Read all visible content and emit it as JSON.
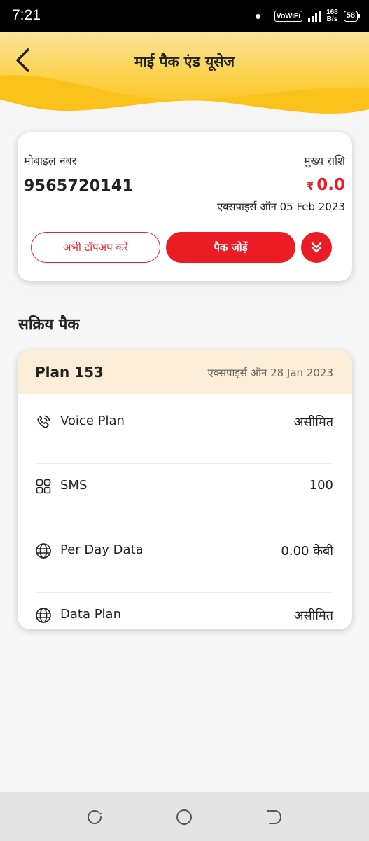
{
  "status_bar": {
    "time": "7:21",
    "network_label": "VoWiFi",
    "speed_value": "168",
    "speed_unit": "B/s",
    "battery": "58"
  },
  "header": {
    "title": "माई पैक एंड यूसेज",
    "gradient_top": "#fde29a",
    "gradient_bottom": "#fbc21c"
  },
  "balance_card": {
    "mobile_label": "मोबाइल नंबर",
    "mobile_number": "9565720141",
    "balance_label": "मुख्य राशि",
    "currency": "₹",
    "balance": "0.0",
    "expiry": "एक्सपाइर्स ऑन 05 Feb 2023",
    "topup_label": "अभी टॉपअप करें",
    "add_pack_label": "पैक जोड़ें",
    "accent_color": "#ec1c24"
  },
  "active_packs": {
    "section_title": "सक्रिय पैक",
    "plan": {
      "name": "Plan 153",
      "expiry": "एक्सपाइर्स ऑन 28 Jan 2023",
      "rows": [
        {
          "icon": "phone-call-icon",
          "label": "Voice Plan",
          "value": "असीमित"
        },
        {
          "icon": "grid-icon",
          "label": "SMS",
          "value": "100"
        },
        {
          "icon": "globe-icon",
          "label": "Per Day Data",
          "value": "0.00 केबी"
        },
        {
          "icon": "globe-icon",
          "label": "Data Plan",
          "value": "असीमित"
        }
      ]
    }
  },
  "nav_bar": {
    "icons": [
      "recent-apps-icon",
      "home-icon",
      "back-icon"
    ]
  }
}
